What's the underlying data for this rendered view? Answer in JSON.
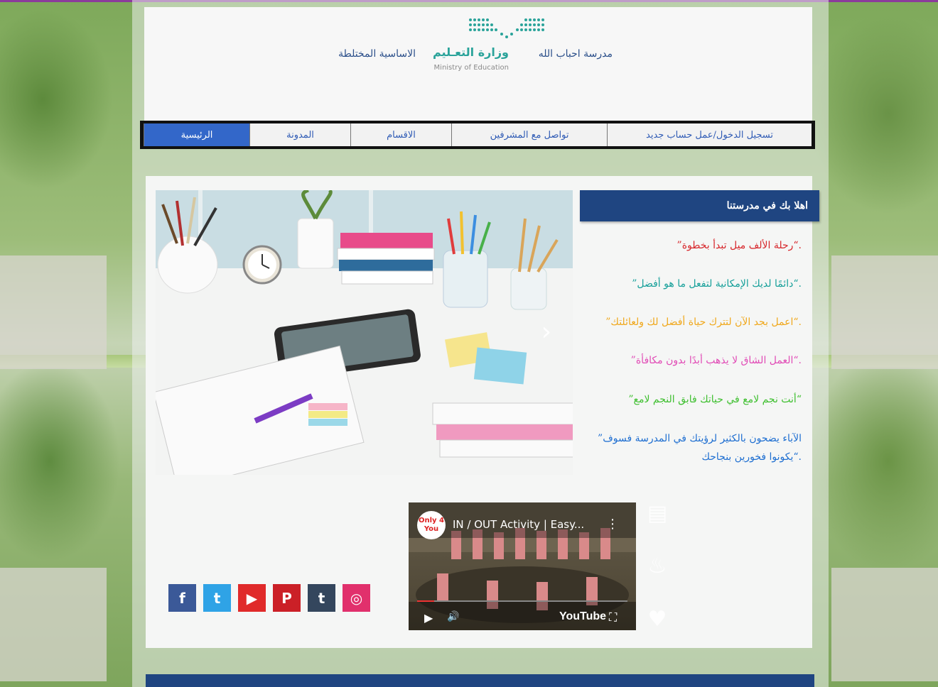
{
  "header": {
    "school_name": "مدرسة احباب الله",
    "ministry_ar": "وزارة التعـليم",
    "ministry_en": "Ministry of Education",
    "school_type": "الاساسية المختلطة"
  },
  "nav": {
    "items": [
      {
        "label": "الرئيسية",
        "active": true
      },
      {
        "label": "المدونة",
        "active": false
      },
      {
        "label": "الاقسام",
        "active": false
      },
      {
        "label": "تواصل مع المشرفين",
        "active": false
      },
      {
        "label": "تسجيل الدخول/عمل حساب جديد",
        "active": false
      }
    ]
  },
  "welcome": {
    "title": "اهلا بك في مدرستنا"
  },
  "quotes": [
    {
      "text": "”رحلة الألف ميل تبدأ بخطوة“.",
      "color": "#d7262b"
    },
    {
      "text": "”دائمًا لديك الإمكانية لتفعل ما هو أفضل“.",
      "color": "#17a09a"
    },
    {
      "text": "”اعمل بجد الآن لتترك حياة أفضل لك ولعائلتك“.",
      "color": "#f0a81c"
    },
    {
      "text": "”العمل الشاق لا يذهب أبدًا بدون مكافأة“.",
      "color": "#e14bb6"
    },
    {
      "text": "”أنت نجم لامع في حياتك فابق النجم لامع“",
      "color": "#3dbf2e"
    },
    {
      "text": "”الآباء يضحون بالكثير لرؤيتك في المدرسة فسوف يكونوا فخورين بنجاحك“.",
      "color": "#1f6fd1"
    }
  ],
  "slideshow": {
    "next_icon": "chevron-right-icon",
    "next_glyph": "›"
  },
  "social": [
    {
      "name": "facebook-icon",
      "glyph": "f",
      "color": "#3b5998"
    },
    {
      "name": "twitter-icon",
      "glyph": "t",
      "color": "#2fa3e6"
    },
    {
      "name": "youtube-icon",
      "glyph": "▶",
      "color": "#e02a2a"
    },
    {
      "name": "pinterest-icon",
      "glyph": "P",
      "color": "#cb2027"
    },
    {
      "name": "tumblr-icon",
      "glyph": "t",
      "color": "#34465d"
    },
    {
      "name": "instagram-icon",
      "glyph": "◎",
      "color": "#e1306c"
    }
  ],
  "video": {
    "channel_badge": "Only 4 You",
    "title": "IN / OUT Activity | Easy...",
    "menu_glyph": "⋮",
    "play_glyph": "▶",
    "volume_glyph": "🔊",
    "brand": "YouTube",
    "fullscreen_glyph": "⛶"
  },
  "side_icons": [
    {
      "name": "document-icon",
      "glyph": "▤"
    },
    {
      "name": "bookmark-flame-icon",
      "glyph": "♨"
    },
    {
      "name": "heart-icon",
      "glyph": "♥"
    }
  ]
}
